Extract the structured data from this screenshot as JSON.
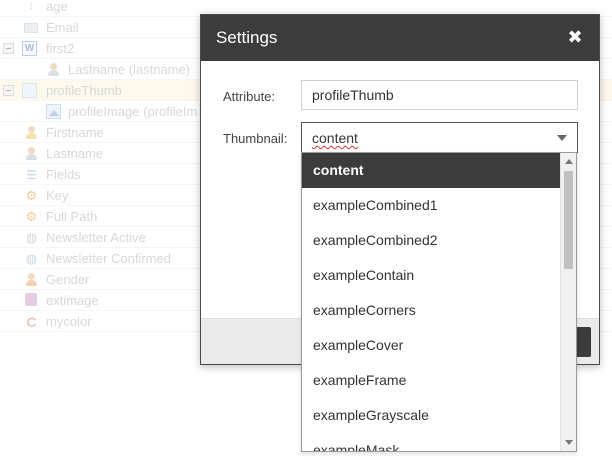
{
  "tree": {
    "rows": [
      {
        "label": "age",
        "icon": "sort-icon"
      },
      {
        "label": "Email",
        "icon": "mail-icon"
      },
      {
        "label": "first2",
        "icon": "word-icon"
      },
      {
        "label": "Lastname (lastname)",
        "icon": "user-icon"
      },
      {
        "label": "profileThumb",
        "icon": "thumbnail-icon"
      },
      {
        "label": "profileImage (profileIm",
        "icon": "image-icon"
      },
      {
        "label": "Firstname",
        "icon": "user-icon"
      },
      {
        "label": "Lastname",
        "icon": "user-icon"
      },
      {
        "label": "Fields",
        "icon": "list-icon"
      },
      {
        "label": "Key",
        "icon": "gear-icon"
      },
      {
        "label": "Full Path",
        "icon": "gear-icon"
      },
      {
        "label": "Newsletter Active",
        "icon": "globe-icon"
      },
      {
        "label": "Newsletter Confirmed",
        "icon": "globe-icon"
      },
      {
        "label": "Gender",
        "icon": "user-icon"
      },
      {
        "label": "extimage",
        "icon": "stack-icon"
      },
      {
        "label": "mycolor",
        "icon": "color-icon"
      }
    ],
    "word_icon_glyph": "W"
  },
  "dialog": {
    "title": "Settings",
    "close_glyph": "✖",
    "attribute_label": "Attribute:",
    "attribute_value": "profileThumb",
    "thumbnail_label": "Thumbnail:",
    "thumbnail_value": "content"
  },
  "dropdown": {
    "options": [
      "content",
      "exampleCombined1",
      "exampleCombined2",
      "exampleContain",
      "exampleCorners",
      "exampleCover",
      "exampleFrame",
      "exampleGrayscale",
      "exampleMask"
    ],
    "selected_index": 0
  },
  "colors": {
    "header_bg": "#3c3c3c",
    "selected_option_bg": "#3c3c3c",
    "selected_row_bg": "#fdf6e3"
  }
}
